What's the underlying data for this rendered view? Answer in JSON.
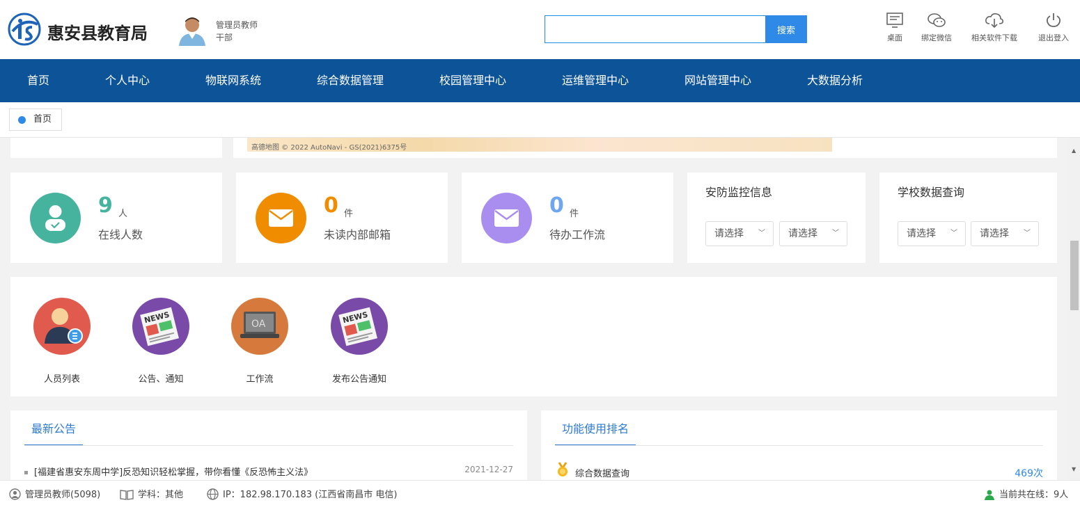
{
  "header": {
    "logo_text": "惠安县教育局",
    "user_name": "管理员教师",
    "user_role": "干部",
    "search_placeholder": "",
    "search_button": "搜索",
    "tools": [
      {
        "label": "桌面",
        "icon": "desktop-icon"
      },
      {
        "label": "绑定微信",
        "icon": "wechat-icon"
      },
      {
        "label": "相关软件下载",
        "icon": "cloud-download-icon"
      },
      {
        "label": "退出登入",
        "icon": "power-icon"
      }
    ]
  },
  "nav": {
    "items": [
      "首页",
      "个人中心",
      "物联网系统",
      "综合数据管理",
      "校园管理中心",
      "运维管理中心",
      "网站管理中心",
      "大数据分析"
    ]
  },
  "tabs": {
    "active": "首页"
  },
  "map": {
    "credit": "高德地图 © 2022 AutoNavi - GS(2021)6375号"
  },
  "stats": [
    {
      "value": "9",
      "unit": "人",
      "label": "在线人数",
      "color": "#45b39d",
      "icon": "user-icon"
    },
    {
      "value": "0",
      "unit": "件",
      "label": "未读内部邮箱",
      "color": "#f08c00",
      "icon": "mail-icon"
    },
    {
      "value": "0",
      "unit": "件",
      "label": "待办工作流",
      "color": "#a98ef0",
      "icon": "mail-icon"
    }
  ],
  "security": {
    "title": "安防监控信息",
    "select1": "请选择",
    "select2": "请选择"
  },
  "school": {
    "title": "学校数据查询",
    "select1": "请选择",
    "select2": "请选择"
  },
  "apps": [
    {
      "label": "人员列表",
      "icon": "person-list-icon"
    },
    {
      "label": "公告、通知",
      "icon": "news-icon"
    },
    {
      "label": "工作流",
      "icon": "oa-laptop-icon"
    },
    {
      "label": "发布公告通知",
      "icon": "news-icon"
    }
  ],
  "notices": {
    "title": "最新公告",
    "items": [
      {
        "text": "[福建省惠安东周中学]反恐知识轻松掌握，带你看懂《反恐怖主义法》",
        "date": "2021-12-27"
      }
    ]
  },
  "ranking": {
    "title": "功能使用排名",
    "items": [
      {
        "name": "综合数据查询",
        "count": "469次"
      }
    ]
  },
  "statusbar": {
    "user": "管理员教师(5098)",
    "subject": "学科：其他",
    "ip": "IP：182.98.170.183 (江西省南昌市 电信)",
    "online": "当前共在线：9人"
  }
}
